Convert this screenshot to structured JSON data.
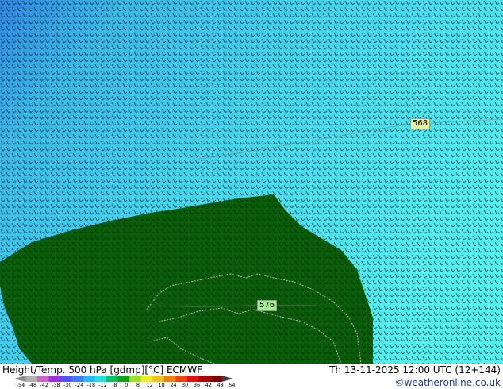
{
  "map": {
    "contour_labels": [
      "568",
      "576"
    ],
    "colors": {
      "sea_cold": "#3ab7e8",
      "sea_mid": "#45d4ee",
      "sea_warm": "#52f0f0",
      "land": "#0a5e0a",
      "coast": "#c8c8c8",
      "barb": "#000000"
    }
  },
  "footer": {
    "product": "Height/Temp. 500 hPa [gdmp][°C] ECMWF",
    "valid": "Th 13-11-2025 12:00 UTC (12+144)",
    "copyright": "©weatheronline.co.uk"
  },
  "colorbar": {
    "ticks": [
      "-54",
      "-48",
      "-42",
      "-38",
      "-30",
      "-24",
      "-18",
      "-12",
      "-8",
      "0",
      "8",
      "12",
      "18",
      "24",
      "30",
      "36",
      "42",
      "48",
      "54"
    ],
    "colors": [
      "#8a8a8a",
      "#b0b0b0",
      "#d060d0",
      "#a030e0",
      "#5050ff",
      "#3a7cff",
      "#20b8ff",
      "#20e0e0",
      "#10c060",
      "#10a010",
      "#a0e020",
      "#f0f020",
      "#f0c020",
      "#f08010",
      "#f04010",
      "#e01010",
      "#b00000",
      "#800000",
      "#404040"
    ]
  }
}
